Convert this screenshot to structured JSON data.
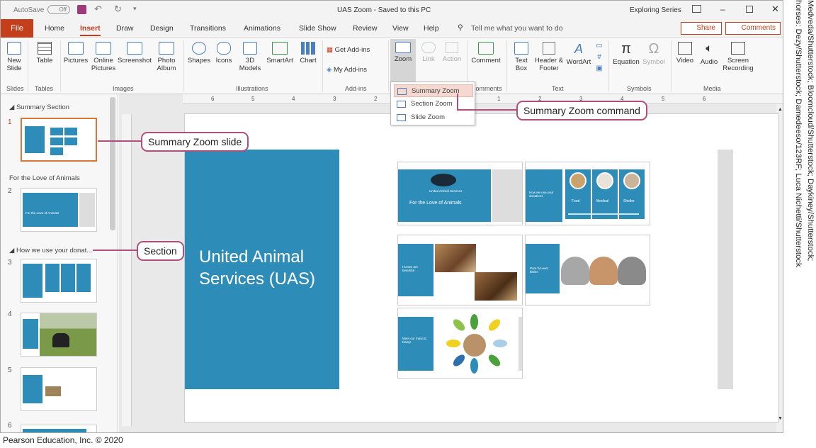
{
  "titlebar": {
    "autosave": "AutoSave",
    "autosave_state": "Off",
    "doc_title": "UAS Zoom  -  Saved to this PC",
    "account": "Exploring Series"
  },
  "tabs": [
    "File",
    "Home",
    "Insert",
    "Draw",
    "Design",
    "Transitions",
    "Animations",
    "Slide Show",
    "Review",
    "View",
    "Help"
  ],
  "tell_me": "Tell me what you want to do",
  "share": "Share",
  "comments": "Comments",
  "ribbon": {
    "new_slide": "New Slide",
    "table": "Table",
    "pictures": "Pictures",
    "online_pictures": "Online Pictures",
    "screenshot": "Screenshot",
    "photo_album": "Photo Album",
    "shapes": "Shapes",
    "icons": "Icons",
    "models_3d": "3D Models",
    "smartart": "SmartArt",
    "chart": "Chart",
    "get_addins": "Get Add-ins",
    "my_addins": "My Add-ins",
    "zoom": "Zoom",
    "link": "Link",
    "action": "Action",
    "comment": "Comment",
    "text_box": "Text Box",
    "header_footer": "Header & Footer",
    "wordart": "WordArt",
    "equation": "Equation",
    "symbol": "Symbol",
    "video": "Video",
    "audio": "Audio",
    "screen_recording": "Screen Recording",
    "groups": {
      "slides": "Slides",
      "tables": "Tables",
      "images": "Images",
      "illustrations": "Illustrations",
      "addins": "Add-ins",
      "comments": "Comments",
      "text": "Text",
      "symbols": "Symbols",
      "media": "Media"
    }
  },
  "zoom_menu": [
    "Summary Zoom",
    "Section Zoom",
    "Slide Zoom"
  ],
  "thumbnails": {
    "sections": [
      "Summary Section",
      "For the Love of Animals",
      "How we use your donat..."
    ],
    "numbers": [
      "1",
      "2",
      "3",
      "4",
      "5",
      "6"
    ],
    "thumb2_text": "For the Love of Animals",
    "thumb3_labels": [
      "Food",
      "Medical",
      "Shelter"
    ]
  },
  "ruler": [
    "6",
    "5",
    "4",
    "3",
    "2",
    "1",
    "0",
    "1",
    "2",
    "3",
    "4",
    "5",
    "6"
  ],
  "slide": {
    "title": "United Animal Services (UAS)",
    "card1_title": "For the Love of Animals",
    "card1_logo": "United Animal Services",
    "card2_text": "How we use your donations",
    "card2_labels": [
      "Food",
      "Medical",
      "Shelter"
    ],
    "card3_text": "Horses are beautiful",
    "card4_text": "Pure fur-ever kitties",
    "card5_text": "Meet our mascot, Daisy!"
  },
  "callouts": {
    "summary_zoom_command": "Summary Zoom command",
    "summary_zoom_slide": "Summary Zoom slide",
    "section": "Section"
  },
  "footer": "Pearson Education, Inc. © 2020",
  "credit_lines": [
    "Medveda/Shutterstock; Bloomcloud/Shutterstock; Daykiney/Shutterstock;",
    "horses: Dezy/Shutterstock; Damedeeso/123RF; Luca Nichetti/Shutterstock"
  ],
  "colors": {
    "file_tab": "#c43e1c",
    "slide_blue": "#2e8db8",
    "callout_border": "#b0507a"
  }
}
